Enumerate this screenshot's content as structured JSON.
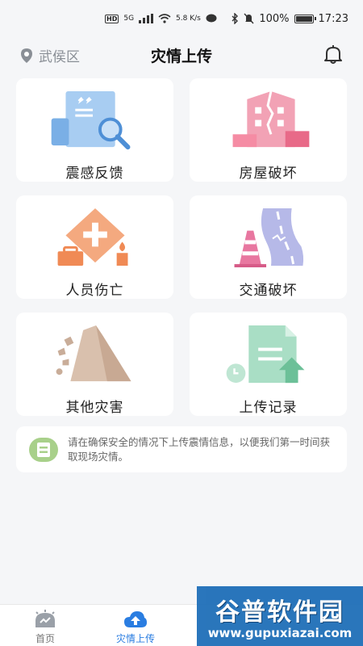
{
  "status_bar": {
    "hd": "HD",
    "signal": "5G",
    "speed": "5.8 K/s",
    "battery": "100%",
    "time": "17:23"
  },
  "header": {
    "location": "武侯区",
    "title": "灾情上传"
  },
  "cards": [
    {
      "label": "震感反馈",
      "icon": "feedback-icon"
    },
    {
      "label": "房屋破坏",
      "icon": "house-damage-icon"
    },
    {
      "label": "人员伤亡",
      "icon": "casualty-icon"
    },
    {
      "label": "交通破坏",
      "icon": "traffic-damage-icon"
    },
    {
      "label": "其他灾害",
      "icon": "landslide-icon"
    },
    {
      "label": "上传记录",
      "icon": "upload-record-icon"
    }
  ],
  "notice": {
    "text": "请在确保安全的情况下上传震情信息，以便我们第一时间获取现场灾情。"
  },
  "bottom_nav": [
    {
      "label": "首页",
      "active": false
    },
    {
      "label": "灾情上传",
      "active": true
    }
  ],
  "watermark": {
    "title": "谷普软件园",
    "url": "www.gupuxiazai.com"
  },
  "colors": {
    "accent": "#2a7de1",
    "background": "#f5f6f8"
  }
}
